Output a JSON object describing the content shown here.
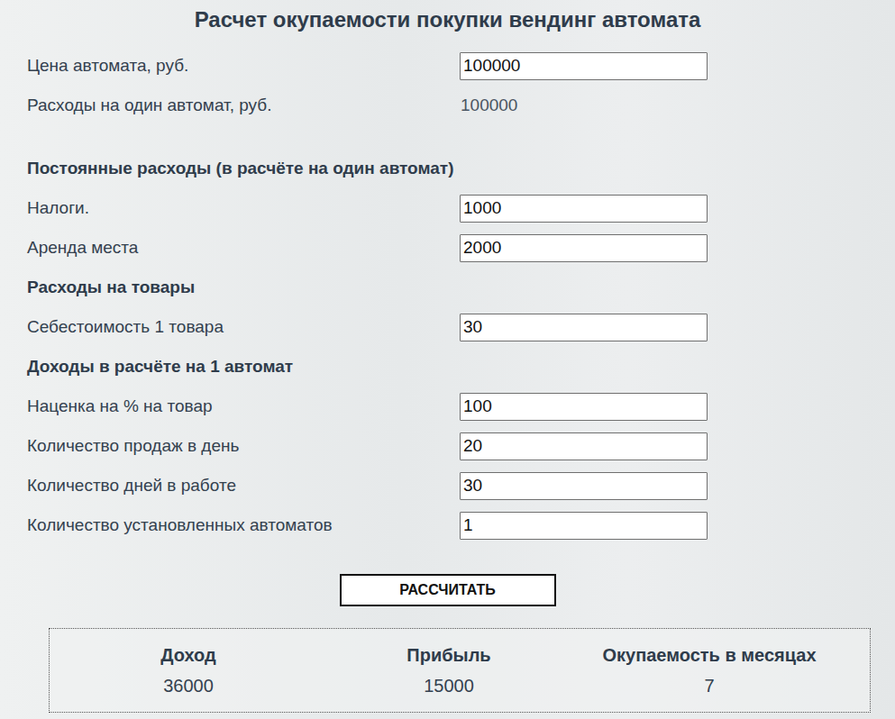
{
  "title": "Расчет окупаемости покупки вендинг автомата",
  "rows": [
    {
      "kind": "input",
      "label": "Цена автомата, руб.",
      "value": "100000"
    },
    {
      "kind": "readonly",
      "label": "Расходы на один автомат, руб.",
      "value": "100000"
    },
    {
      "kind": "heading",
      "label": "Постоянные расходы (в расчёте на один автомат)"
    },
    {
      "kind": "input",
      "label": "Налоги.",
      "value": "1000"
    },
    {
      "kind": "input",
      "label": "Аренда места",
      "value": "2000"
    },
    {
      "kind": "heading",
      "label": "Расходы на товары"
    },
    {
      "kind": "input",
      "label": "Себестоимость 1 товара",
      "value": "30"
    },
    {
      "kind": "heading",
      "label": "Доходы в расчёте на 1 автомат"
    },
    {
      "kind": "input",
      "label": "Наценка на % на товар",
      "value": "100"
    },
    {
      "kind": "input",
      "label": "Количество продаж в день",
      "value": "20"
    },
    {
      "kind": "input",
      "label": "Количество дней в работе",
      "value": "30"
    },
    {
      "kind": "input",
      "label": "Количество установленных автоматов",
      "value": "1"
    }
  ],
  "button": "РАССЧИТАТЬ",
  "results": [
    {
      "label": "Доход",
      "value": "36000"
    },
    {
      "label": "Прибыль",
      "value": "15000"
    },
    {
      "label": "Окупаемость в месяцах",
      "value": "7"
    }
  ]
}
